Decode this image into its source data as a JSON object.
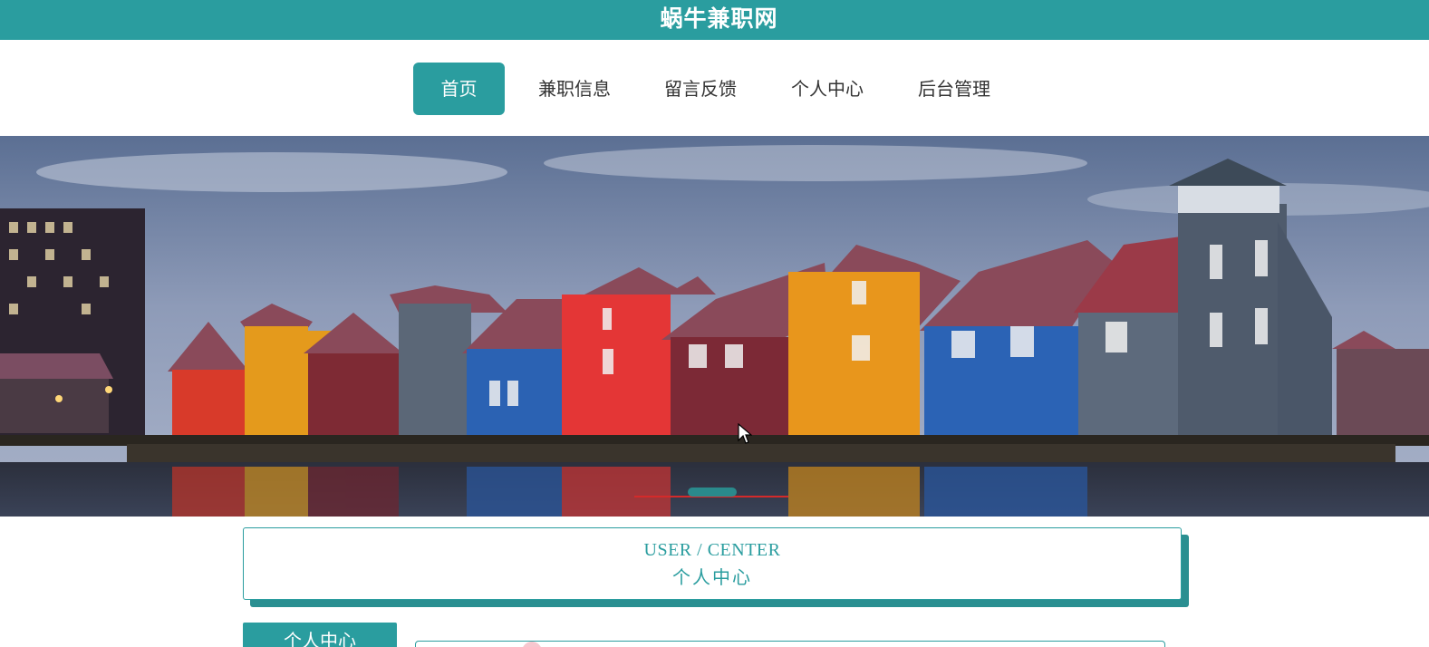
{
  "header": {
    "site_title": "蜗牛兼职网"
  },
  "nav": {
    "items": [
      {
        "label": "首页",
        "active": true
      },
      {
        "label": "兼职信息",
        "active": false
      },
      {
        "label": "留言反馈",
        "active": false
      },
      {
        "label": "个人中心",
        "active": false
      },
      {
        "label": "后台管理",
        "active": false
      }
    ]
  },
  "banner": {
    "description_icon": "carousel-banner",
    "active_slide": 2
  },
  "user_center": {
    "title_en": "USER / CENTER",
    "title_cn": "个人中心"
  },
  "sidebar": {
    "tab_label": "个人中心"
  },
  "colors": {
    "accent": "#2a9d9f",
    "dark_accent": "#2a8a8c",
    "indicator_red": "#d42a2a"
  }
}
